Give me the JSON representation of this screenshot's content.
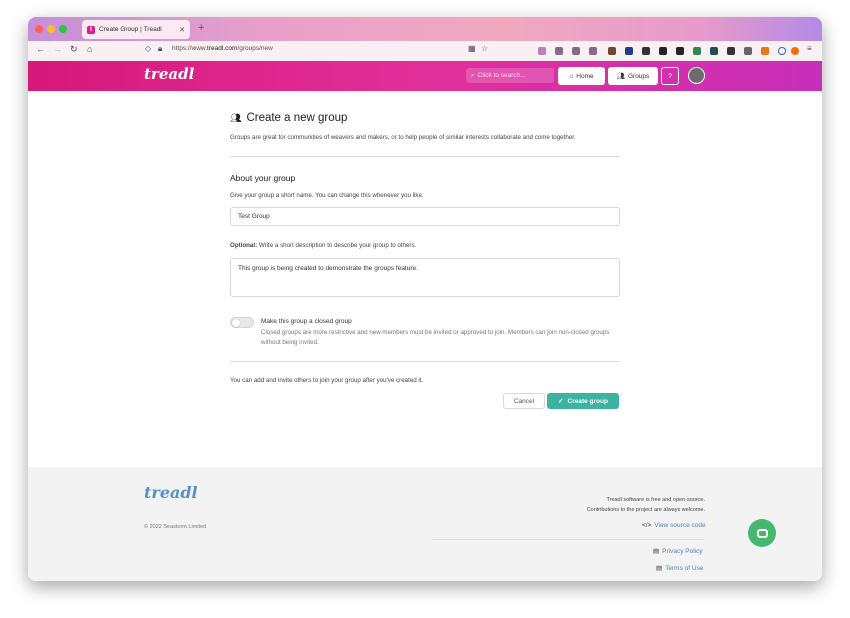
{
  "browser": {
    "tab_title": "Create Group | Treadl",
    "tab_favicon": "t",
    "new_tab": "+",
    "url_prefix": "https://www.",
    "url_domain": "treadl.com",
    "url_path": "/groups/new",
    "colors": {
      "close": "#fe5f57",
      "minimize": "#febc2e",
      "maximize": "#28c840"
    }
  },
  "header": {
    "logo": "treadl",
    "search_placeholder": "Click to search...",
    "home_label": "Home",
    "groups_label": "Groups",
    "help_label": "?",
    "accent": "#d6197a"
  },
  "page": {
    "title": "Create a new group",
    "lead": "Groups are great for communities of weavers and makers, or to help people of similar interests collaborate and come together.",
    "section_title": "About your group",
    "name_help": "Give your group a short name. You can change this whenever you like.",
    "name_value": "Test Group",
    "desc_help_bold": "Optional:",
    "desc_help_rest": " Write a short description to describe your group to others.",
    "desc_value": "This group is being created to demonstrate the groups feature.",
    "closed_label": "Make this group a closed group",
    "closed_desc": "Closed groups are more restrictive and new members must be invited or approved to join. Members can join non-closed groups without being invited.",
    "invite_note": "You can add and invite others to join your group after you've created it.",
    "cancel_label": "Cancel",
    "create_label": "Create group",
    "create_color": "#3bb3a0"
  },
  "footer": {
    "logo": "treadl",
    "copyright": "© 2022 Seastorm Limited",
    "oss_line1": "Treadl software is free and open-source.",
    "oss_line2": "Contributions to the project are always welcome.",
    "source_link": "View source code",
    "privacy_link": "Privacy Policy",
    "terms_link": "Terms of Use",
    "link_color": "#4d7fc3"
  }
}
